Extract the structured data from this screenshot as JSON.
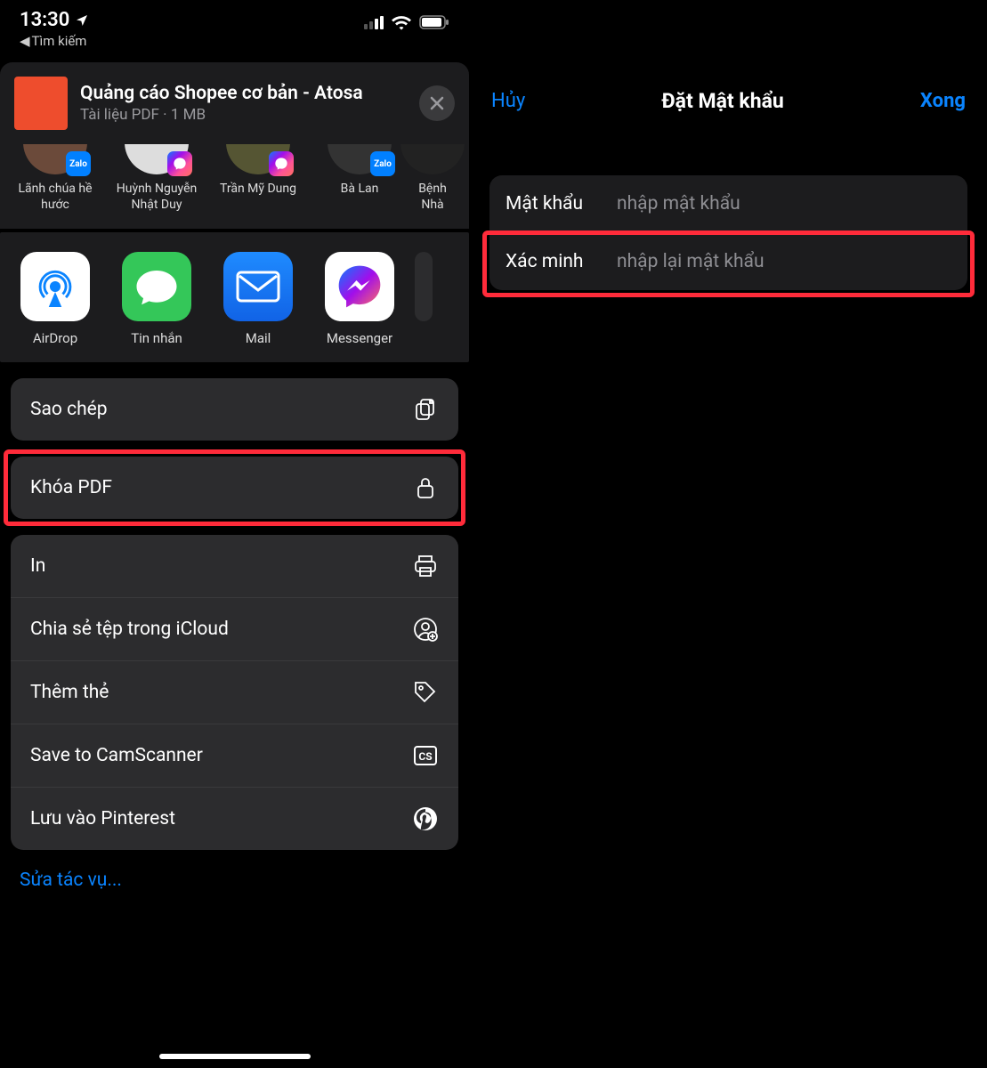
{
  "left": {
    "status": {
      "time": "13:30",
      "back_label": "Tìm kiếm"
    },
    "header": {
      "title": "Quảng cáo Shopee cơ bản - Atosa",
      "subtitle": "Tài liệu PDF · 1 MB"
    },
    "contacts": [
      {
        "name": "Lãnh chúa hề hước",
        "badge": "zalo"
      },
      {
        "name": "Huỳnh Nguyễn Nhật Duy",
        "badge": "messenger"
      },
      {
        "name": "Trần Mỹ Dung",
        "badge": "messenger"
      },
      {
        "name": "Bà Lan",
        "badge": "zalo"
      },
      {
        "name": "Bệnh Nhà",
        "badge": ""
      }
    ],
    "apps": [
      {
        "label": "AirDrop",
        "icon": "airdrop"
      },
      {
        "label": "Tin nhắn",
        "icon": "messages"
      },
      {
        "label": "Mail",
        "icon": "mail"
      },
      {
        "label": "Messenger",
        "icon": "messenger"
      },
      {
        "label": "",
        "icon": "more"
      }
    ],
    "actions_group1": [
      {
        "label": "Sao chép",
        "icon": "copy"
      }
    ],
    "actions_group2": [
      {
        "label": "Khóa PDF",
        "icon": "lock"
      }
    ],
    "actions_group3": [
      {
        "label": "In",
        "icon": "print"
      },
      {
        "label": "Chia sẻ tệp trong iCloud",
        "icon": "person-add"
      },
      {
        "label": "Thêm thẻ",
        "icon": "tag"
      },
      {
        "label": "Save to CamScanner",
        "icon": "cs"
      },
      {
        "label": "Lưu vào Pinterest",
        "icon": "pinterest"
      }
    ],
    "edit_actions": "Sửa tác vụ..."
  },
  "right": {
    "nav": {
      "cancel": "Hủy",
      "title": "Đặt Mật khẩu",
      "done": "Xong"
    },
    "fields": [
      {
        "label": "Mật khẩu",
        "placeholder": "nhập mật khẩu"
      },
      {
        "label": "Xác minh",
        "placeholder": "nhập lại mật khẩu"
      }
    ]
  }
}
